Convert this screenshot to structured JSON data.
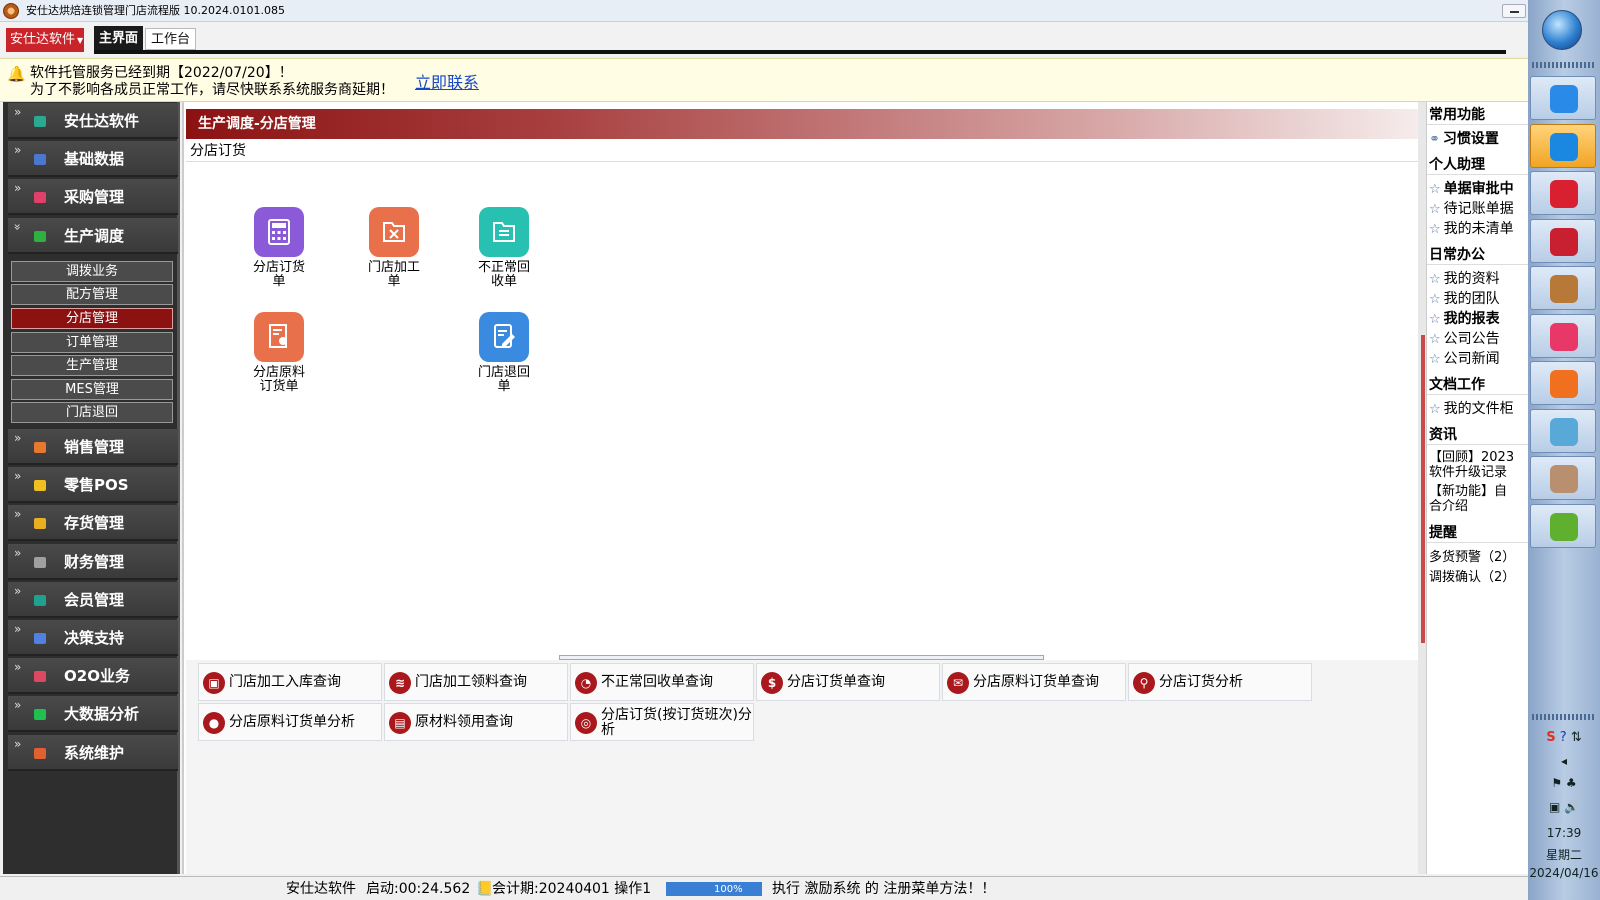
{
  "window": {
    "title": "安仕达烘焙连锁管理门店流程版  10.2024.0101.085"
  },
  "menu": {
    "brand": "安仕达软件",
    "tabs": [
      "主界面",
      "工作台"
    ]
  },
  "notice": {
    "line1": "软件托管服务已经到期【2022/07/20】！",
    "line2": "为了不影响各成员正常工作，请尽快联系系统服务商延期！",
    "link": "立即联系"
  },
  "sidebar": {
    "items": [
      {
        "label": "安仕达软件",
        "icon": "teal-cube-icon",
        "color": "#2aa890"
      },
      {
        "label": "基础数据",
        "icon": "blue-cube-icon",
        "color": "#4a78d0"
      },
      {
        "label": "采购管理",
        "icon": "pink-cube-icon",
        "color": "#e0406a"
      },
      {
        "label": "生产调度",
        "icon": "green-cube-icon",
        "color": "#30b040",
        "expanded": true
      },
      {
        "label": "销售管理",
        "icon": "orange-cube-icon",
        "color": "#e87830"
      },
      {
        "label": "零售POS",
        "icon": "yellow-cube-icon",
        "color": "#f0c020"
      },
      {
        "label": "存货管理",
        "icon": "gold-cube-icon",
        "color": "#e8b020"
      },
      {
        "label": "财务管理",
        "icon": "gray-cube-icon",
        "color": "#a0a0a0"
      },
      {
        "label": "会员管理",
        "icon": "teal-cube-icon",
        "color": "#20a090"
      },
      {
        "label": "决策支持",
        "icon": "blue-cube-icon",
        "color": "#5080e0"
      },
      {
        "label": "O2O业务",
        "icon": "pink-cube-icon",
        "color": "#e04860"
      },
      {
        "label": "大数据分析",
        "icon": "green-cube-icon",
        "color": "#20c050"
      },
      {
        "label": "系统维护",
        "icon": "orange-cube-icon",
        "color": "#e06030"
      }
    ],
    "subitems": [
      {
        "label": "调拨业务"
      },
      {
        "label": "配方管理"
      },
      {
        "label": "分店管理",
        "active": true
      },
      {
        "label": "订单管理"
      },
      {
        "label": "生产管理"
      },
      {
        "label": "MES管理"
      },
      {
        "label": "门店退回"
      }
    ]
  },
  "main": {
    "header": "生产调度-分店管理",
    "section": "分店订货",
    "apps": [
      {
        "label": "分店订货单",
        "icon": "calculator-icon",
        "color": "#8a5ad8"
      },
      {
        "label": "门店加工单",
        "icon": "tools-folder-icon",
        "color": "#e8704a"
      },
      {
        "label": "不正常回收单",
        "icon": "folder-list-icon",
        "color": "#28c0b0"
      },
      {
        "label": "分店原料订货单",
        "icon": "document-person-icon",
        "color": "#e8704a"
      },
      {
        "label": "门店退回单",
        "icon": "edit-document-icon",
        "color": "#3a8ae0"
      }
    ],
    "queries": [
      {
        "label": "门店加工入库查询",
        "icon": "inbox-icon"
      },
      {
        "label": "门店加工领料查询",
        "icon": "layers-icon"
      },
      {
        "label": "不正常回收单查询",
        "icon": "pie-icon"
      },
      {
        "label": "分店订货单查询",
        "icon": "dollar-icon"
      },
      {
        "label": "分店原料订货单查询",
        "icon": "mail-icon"
      },
      {
        "label": "分店订货分析",
        "icon": "magnifier-icon"
      },
      {
        "label": "分店原料订货单分析",
        "icon": "person-icon"
      },
      {
        "label": "原材料领用查询",
        "icon": "monitor-icon"
      },
      {
        "label": "分店订货(按订货班次)分析",
        "icon": "lifebuoy-icon"
      }
    ]
  },
  "rightpanel": {
    "sections": [
      {
        "title": "常用功能",
        "links": [
          {
            "label": "习惯设置",
            "bold": true,
            "icon": "link-icon"
          }
        ]
      },
      {
        "title": "个人助理",
        "links": [
          {
            "label": "单据审批中",
            "bold": true
          },
          {
            "label": "待记账单据"
          },
          {
            "label": "我的未清单"
          }
        ]
      },
      {
        "title": "日常办公",
        "links": [
          {
            "label": "我的资料"
          },
          {
            "label": "我的团队"
          },
          {
            "label": "我的报表",
            "bold": true
          },
          {
            "label": "公司公告"
          },
          {
            "label": "公司新闻"
          }
        ]
      },
      {
        "title": "文档工作",
        "links": [
          {
            "label": "我的文件柜"
          }
        ]
      },
      {
        "title": "资讯",
        "news": [
          "【回顾】2023",
          "软件升级记录",
          "【新功能】自",
          "合介绍"
        ]
      },
      {
        "title": "提醒",
        "reminders": [
          "多货预警（2）",
          "调拨确认（2）"
        ]
      }
    ]
  },
  "status": {
    "company": "安仕达软件",
    "uptime": "启动:00:24.562",
    "period": "会计期:202404",
    "user": "01 操作1",
    "progress": 100,
    "progress_label": "100%",
    "message": "执行 激励系统 的 注册菜单方法！！"
  },
  "taskbar": {
    "time": "17:39",
    "weekday": "星期二",
    "date": "2024/04/16",
    "apps": [
      {
        "icon": "feishu-icon",
        "color": "#2a8ae8"
      },
      {
        "icon": "chat-bubble-icon",
        "color": "#1a88e0",
        "active": true
      },
      {
        "icon": "m-logo-icon",
        "color": "#d82030"
      },
      {
        "icon": "globe-icon",
        "color": "#c82030"
      },
      {
        "icon": "pie-avatar-icon",
        "color": "#b87838"
      },
      {
        "icon": "bowtie-app-icon",
        "color": "#e83868"
      },
      {
        "icon": "firefox-icon",
        "color": "#f07020"
      },
      {
        "icon": "notebook-icon",
        "color": "#58a8d8"
      },
      {
        "icon": "user-avatar-icon",
        "color": "#b89070"
      },
      {
        "icon": "apple-icon",
        "color": "#60b030"
      }
    ]
  }
}
